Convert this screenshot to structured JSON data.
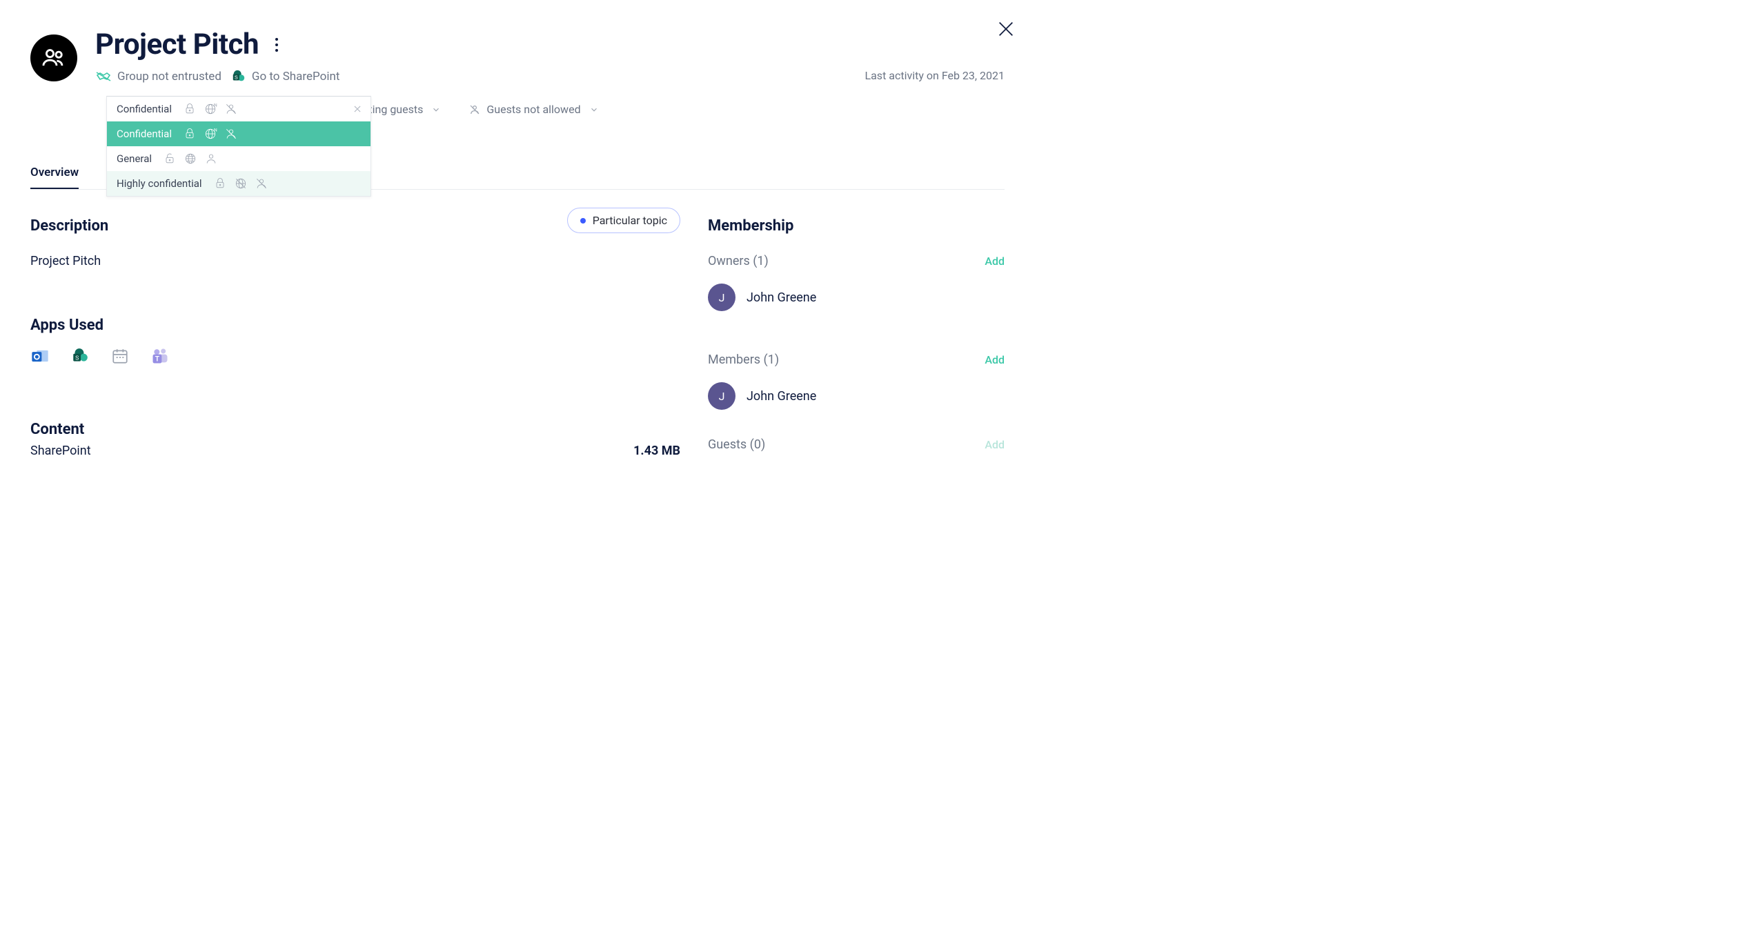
{
  "header": {
    "title": "Project Pitch",
    "trust_label": "Group not entrusted",
    "sharepoint_label": "Go to SharePoint",
    "last_activity": "Last activity on Feb 23, 2021"
  },
  "controls": {
    "sharing_label": "nd existing guests",
    "guests_label": "Guests not allowed"
  },
  "sensitivity_dropdown": {
    "current": "Confidential",
    "options": [
      {
        "label": "Confidential",
        "selected": true
      },
      {
        "label": "General",
        "selected": false
      },
      {
        "label": "Highly confidential",
        "selected": false
      }
    ]
  },
  "tabs": {
    "overview": "Overview"
  },
  "description": {
    "heading": "Description",
    "text": "Project Pitch",
    "topic_pill": "Particular topic"
  },
  "apps": {
    "heading": "Apps Used"
  },
  "content": {
    "heading": "Content",
    "storage_label": "SharePoint",
    "storage_value": "1.43 MB"
  },
  "membership": {
    "heading": "Membership",
    "owners_label": "Owners (1)",
    "members_label": "Members (1)",
    "guests_label": "Guests (0)",
    "add_label": "Add",
    "owners": [
      {
        "initial": "J",
        "name": "John Greene"
      }
    ],
    "members": [
      {
        "initial": "J",
        "name": "John Greene"
      }
    ]
  }
}
